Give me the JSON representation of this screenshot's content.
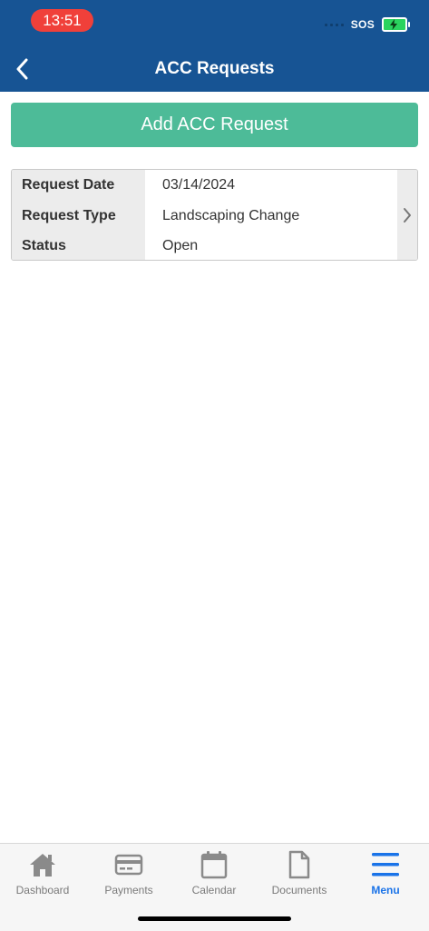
{
  "status_bar": {
    "time": "13:51",
    "carrier": "SOS"
  },
  "header": {
    "title": "ACC Requests",
    "back_icon": "chevron-left-icon"
  },
  "add_button": {
    "label": "Add ACC Request"
  },
  "request": {
    "rows": [
      {
        "label": "Request Date",
        "value": "03/14/2024"
      },
      {
        "label": "Request Type",
        "value": "Landscaping Change"
      },
      {
        "label": "Status",
        "value": "Open"
      }
    ],
    "chevron_icon": "chevron-right-icon"
  },
  "tabbar": {
    "tabs": [
      {
        "label": "Dashboard",
        "icon": "home-icon"
      },
      {
        "label": "Payments",
        "icon": "card-icon"
      },
      {
        "label": "Calendar",
        "icon": "calendar-icon"
      },
      {
        "label": "Documents",
        "icon": "document-icon"
      },
      {
        "label": "Menu",
        "icon": "menu-icon"
      }
    ],
    "active_index": 4
  },
  "colors": {
    "header_bg": "#175494",
    "add_button_bg": "#4dbb98",
    "time_pill": "#f0403a",
    "active_tab": "#1a73e8"
  }
}
